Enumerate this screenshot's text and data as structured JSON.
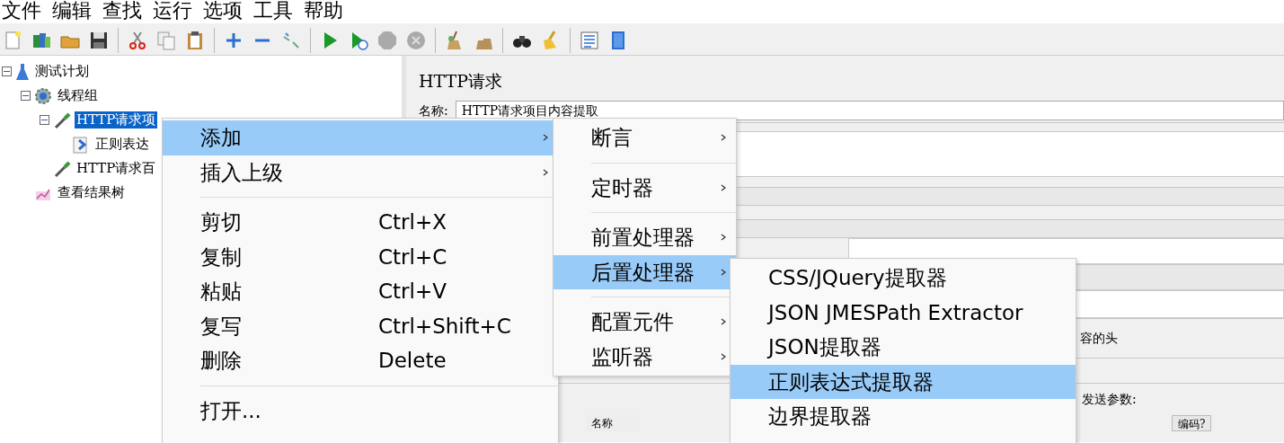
{
  "menu_bar": [
    "文件",
    "编辑",
    "查找",
    "运行",
    "选项",
    "工具",
    "帮助"
  ],
  "tree": [
    {
      "label": "测试计划",
      "kind": "plan",
      "expanded": true,
      "selected": false,
      "children": [
        {
          "label": "线程组",
          "kind": "thread_group",
          "expanded": true,
          "selected": false,
          "children": [
            {
              "label": "HTTP请求项",
              "kind": "sampler",
              "expanded": true,
              "selected": true,
              "children": [
                {
                  "label": "正则表达",
                  "kind": "extractor",
                  "selected": false
                }
              ]
            },
            {
              "label": "HTTP请求百",
              "kind": "sampler",
              "selected": false
            }
          ]
        },
        {
          "label": "查看结果树",
          "kind": "listener",
          "selected": false
        }
      ]
    }
  ],
  "panel": {
    "title": "HTTP请求",
    "name_label": "名称:",
    "name_value": "HTTP请求项目内容提取",
    "header_hint": "容的头",
    "params_label": "发送参数:",
    "table_columns": [
      "名称",
      "编码?"
    ]
  },
  "context_menu": [
    {
      "kind": "item",
      "label": "添加",
      "submenu": true,
      "selected": true
    },
    {
      "kind": "item",
      "label": "插入上级",
      "submenu": true,
      "selected": false
    },
    {
      "kind": "separator"
    },
    {
      "kind": "item",
      "label": "剪切",
      "shortcut": "Ctrl+X",
      "selected": false
    },
    {
      "kind": "item",
      "label": "复制",
      "shortcut": "Ctrl+C",
      "selected": false
    },
    {
      "kind": "item",
      "label": "粘贴",
      "shortcut": "Ctrl+V",
      "selected": false
    },
    {
      "kind": "item",
      "label": "复写",
      "shortcut": "Ctrl+Shift+C",
      "selected": false
    },
    {
      "kind": "item",
      "label": "删除",
      "shortcut": "Delete",
      "selected": false
    },
    {
      "kind": "separator"
    },
    {
      "kind": "item",
      "label": "打开...",
      "selected": false
    }
  ],
  "add_submenu": [
    {
      "kind": "item",
      "label": "断言",
      "submenu": true,
      "selected": false
    },
    {
      "kind": "separator"
    },
    {
      "kind": "item",
      "label": "定时器",
      "submenu": true,
      "selected": false
    },
    {
      "kind": "separator"
    },
    {
      "kind": "item",
      "label": "前置处理器",
      "submenu": true,
      "selected": false
    },
    {
      "kind": "item",
      "label": "后置处理器",
      "submenu": true,
      "selected": true
    },
    {
      "kind": "separator"
    },
    {
      "kind": "item",
      "label": "配置元件",
      "submenu": true,
      "selected": false
    },
    {
      "kind": "item",
      "label": "监听器",
      "submenu": true,
      "selected": false
    }
  ],
  "post_processor_submenu": [
    {
      "kind": "item",
      "label": "CSS/JQuery提取器",
      "selected": false
    },
    {
      "kind": "item",
      "label": "JSON JMESPath Extractor",
      "selected": false
    },
    {
      "kind": "item",
      "label": "JSON提取器",
      "selected": false
    },
    {
      "kind": "item",
      "label": "正则表达式提取器",
      "selected": true
    },
    {
      "kind": "item",
      "label": "边界提取器",
      "selected": false
    }
  ]
}
